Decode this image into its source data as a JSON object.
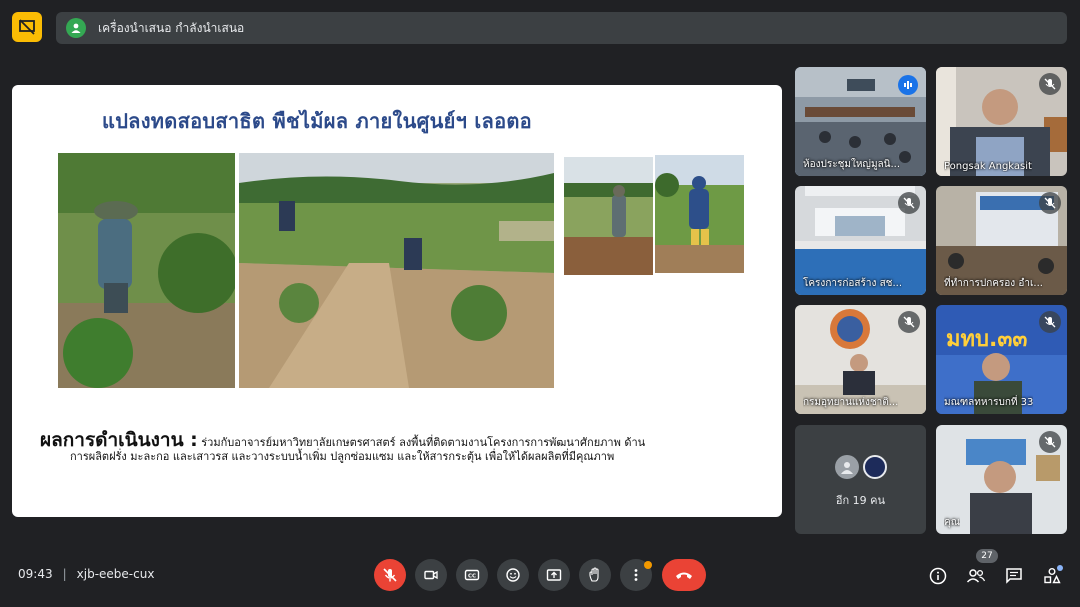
{
  "banner": {
    "text": "เครื่องนำเสนอ กำลังนำเสนอ"
  },
  "slide": {
    "title": "แปลงทดสอบสาธิต พืชไม้ผล  ภายในศูนย์ฯ เลอตอ",
    "result_heading": "ผลการดำเนินงาน :",
    "result_text_1": " ร่วมกับอาจารย์มหาวิทยาลัยเกษตรศาสตร์ ลงพื้นที่ติดตามงานโครงการการพัฒนาศักยภาพ ด้าน",
    "result_text_2": "การผลิตฝรั่ง มะละกอ และเสาวรส และวางระบบน้ำเพิ่ม  ปลูกซ่อมแซม และให้สารกระตุ้น เพื่อให้ได้ผลผลิตที่มีคุณภาพ"
  },
  "participants": [
    {
      "name": "ห้องประชุมใหญ่มูลนิ...",
      "status": "speaking"
    },
    {
      "name": "Pongsak Angkasit",
      "status": "muted"
    },
    {
      "name": "โครงการก่อสร้าง สช...",
      "status": "muted"
    },
    {
      "name": "ที่ทำการปกครอง อำเ...",
      "status": "muted"
    },
    {
      "name": "กรมอุทยานแห่งชาติ...",
      "status": "muted"
    },
    {
      "name": "มณฑลทหารบกที่ 33",
      "status": "muted"
    },
    {
      "name": "คุณ",
      "status": "muted"
    }
  ],
  "others": {
    "label": "อีก 19 คน"
  },
  "tile_banner_text": "มทบ.๓๓",
  "meeting": {
    "time": "09:43",
    "separator": "|",
    "code": "xjb-eebe-cux"
  },
  "people_count": "27",
  "colors": {
    "hangup": "#ea4335",
    "speaking": "#1a73e8",
    "present_icon": "#fbbc04"
  }
}
